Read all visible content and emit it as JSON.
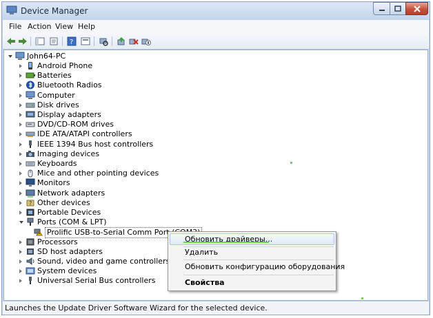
{
  "window": {
    "title": "Device Manager"
  },
  "menu": [
    "File",
    "Action",
    "View",
    "Help"
  ],
  "toolbar_icons": [
    "back-arrow-icon",
    "forward-arrow-icon",
    "show-hide-console-tree-icon",
    "properties-icon",
    "help-icon",
    "view-icon",
    "scan-hardware-icon",
    "update-driver-icon",
    "uninstall-icon",
    "disable-icon"
  ],
  "tree": {
    "root": "John64-PC",
    "items": [
      {
        "label": "Android Phone",
        "icon": "phone-icon"
      },
      {
        "label": "Batteries",
        "icon": "battery-icon"
      },
      {
        "label": "Bluetooth Radios",
        "icon": "bluetooth-icon"
      },
      {
        "label": "Computer",
        "icon": "computer-icon"
      },
      {
        "label": "Disk drives",
        "icon": "disk-drive-icon"
      },
      {
        "label": "Display adapters",
        "icon": "display-adapter-icon"
      },
      {
        "label": "DVD/CD-ROM drives",
        "icon": "dvd-drive-icon"
      },
      {
        "label": "IDE ATA/ATAPI controllers",
        "icon": "ide-controller-icon"
      },
      {
        "label": "IEEE 1394 Bus host controllers",
        "icon": "ieee1394-icon"
      },
      {
        "label": "Imaging devices",
        "icon": "camera-icon"
      },
      {
        "label": "Keyboards",
        "icon": "keyboard-icon"
      },
      {
        "label": "Mice and other pointing devices",
        "icon": "mouse-icon"
      },
      {
        "label": "Monitors",
        "icon": "monitor-icon"
      },
      {
        "label": "Network adapters",
        "icon": "network-adapter-icon"
      },
      {
        "label": "Other devices",
        "icon": "other-devices-icon"
      },
      {
        "label": "Portable Devices",
        "icon": "portable-device-icon"
      },
      {
        "label": "Ports (COM & LPT)",
        "icon": "port-icon",
        "expanded": true
      },
      {
        "label": "Prolific USB-to-Serial Comm Port (COM3)",
        "icon": "warning-port-icon",
        "child": true
      },
      {
        "label": "Processors",
        "icon": "processor-icon"
      },
      {
        "label": "SD host adapters",
        "icon": "sd-adapter-icon"
      },
      {
        "label": "Sound, video and game controllers",
        "icon": "sound-icon"
      },
      {
        "label": "System devices",
        "icon": "system-devices-icon"
      },
      {
        "label": "Universal Serial Bus controllers",
        "icon": "usb-icon"
      }
    ]
  },
  "context_menu": {
    "update_drivers": "Обновить драйверы...",
    "delete": "Удалить",
    "scan_hardware": "Обновить конфигурацию оборудования",
    "properties": "Свойства"
  },
  "status": "Launches the Update Driver Software Wizard for the selected device.",
  "colors": {
    "highlight_underline": "#7ad047",
    "close_button": "#c7503b"
  }
}
